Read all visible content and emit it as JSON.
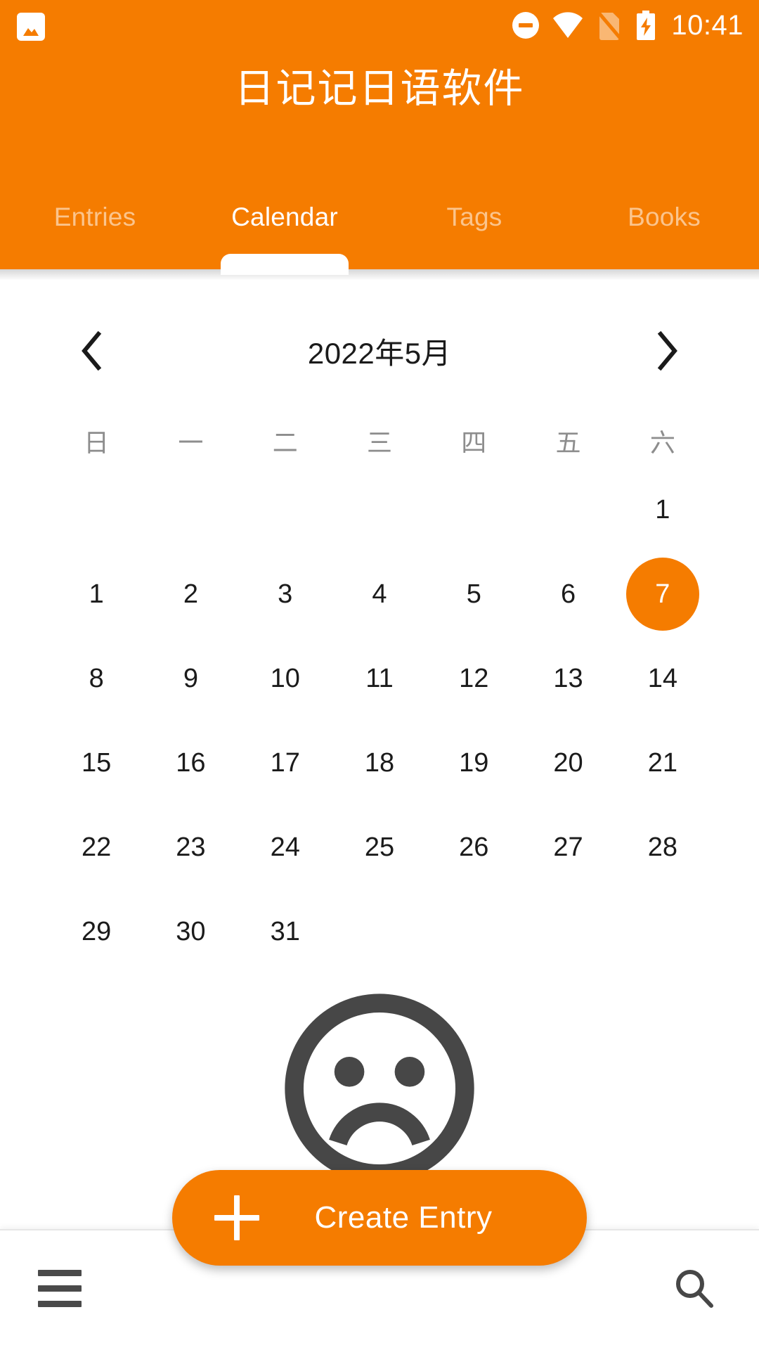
{
  "statusbar": {
    "app_icon": "image-icon",
    "dnd_icon": "do-not-disturb-icon",
    "wifi_icon": "wifi-icon",
    "sim_icon": "no-sim-card-icon",
    "battery_icon": "battery-charging-icon",
    "time": "10:41"
  },
  "header": {
    "title": "日记记日语软件",
    "accent_color": "#F57C00",
    "tabs": [
      {
        "label": "Entries",
        "active": false
      },
      {
        "label": "Calendar",
        "active": true
      },
      {
        "label": "Tags",
        "active": false
      },
      {
        "label": "Books",
        "active": false
      }
    ]
  },
  "calendar": {
    "prev_icon": "chevron-left-icon",
    "next_icon": "chevron-right-icon",
    "month_label": "2022年5月",
    "weekdays": [
      "日",
      "一",
      "二",
      "三",
      "四",
      "五",
      "六"
    ],
    "selected_day": 7,
    "selected_color": "#F57C00",
    "weeks": [
      [
        "",
        "",
        "",
        "",
        "",
        "",
        "1"
      ],
      [
        "1",
        "2",
        "3",
        "4",
        "5",
        "6",
        "7"
      ],
      [
        "8",
        "9",
        "10",
        "11",
        "12",
        "13",
        "14"
      ],
      [
        "15",
        "16",
        "17",
        "18",
        "19",
        "20",
        "21"
      ],
      [
        "22",
        "23",
        "24",
        "25",
        "26",
        "27",
        "28"
      ],
      [
        "29",
        "30",
        "31",
        "",
        "",
        "",
        ""
      ]
    ]
  },
  "empty_state": {
    "icon": "sad-face-icon"
  },
  "fab": {
    "icon": "plus-icon",
    "label": "Create Entry"
  },
  "bottombar": {
    "menu_icon": "hamburger-menu-icon",
    "search_icon": "search-icon"
  }
}
